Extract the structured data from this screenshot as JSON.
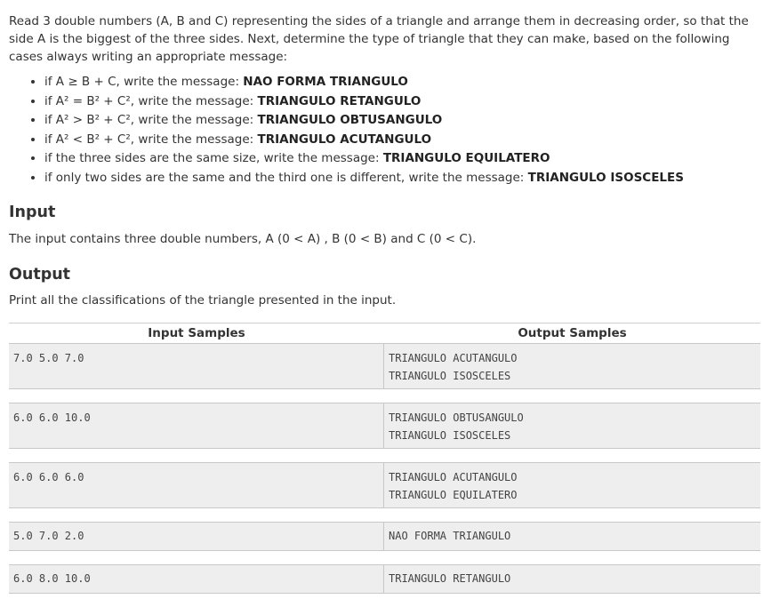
{
  "intro": "Read 3 double numbers (A, B and C) representing the sides of a triangle and arrange them in decreasing order, so that the side A is the biggest of the three sides. Next, determine the type of triangle that they can make, based on the following cases always writing an appropriate message:",
  "cases": [
    {
      "condition": "if A ≥ B + C, write the message: ",
      "message": "NAO FORMA TRIANGULO"
    },
    {
      "condition": "if A² = B² + C², write the message: ",
      "message": "TRIANGULO RETANGULO"
    },
    {
      "condition": "if A² > B² + C², write the message: ",
      "message": "TRIANGULO OBTUSANGULO"
    },
    {
      "condition": "if A² < B² + C², write the message: ",
      "message": "TRIANGULO ACUTANGULO"
    },
    {
      "condition": "if the three sides are the same size, write the message: ",
      "message": "TRIANGULO EQUILATERO"
    },
    {
      "condition": "if only two sides are the same and the third one is different, write the message: ",
      "message": "TRIANGULO ISOSCELES"
    }
  ],
  "input_section": {
    "title": "Input",
    "text": "The input contains three double numbers, A (0 < A) , B (0 < B) and C (0 < C)."
  },
  "output_section": {
    "title": "Output",
    "text": "Print all the classifications of the triangle presented in the input."
  },
  "samples": {
    "input_header": "Input Samples",
    "output_header": "Output Samples",
    "rows": [
      {
        "input": "7.0 5.0 7.0",
        "output": [
          "TRIANGULO ACUTANGULO",
          "TRIANGULO ISOSCELES"
        ]
      },
      {
        "input": "6.0 6.0 10.0",
        "output": [
          "TRIANGULO OBTUSANGULO",
          "TRIANGULO ISOSCELES"
        ]
      },
      {
        "input": "6.0 6.0 6.0",
        "output": [
          "TRIANGULO ACUTANGULO",
          "TRIANGULO EQUILATERO"
        ]
      },
      {
        "input": "5.0 7.0 2.0",
        "output": [
          "NAO FORMA TRIANGULO"
        ]
      },
      {
        "input": "6.0 8.0 10.0",
        "output": [
          "TRIANGULO RETANGULO"
        ]
      }
    ]
  }
}
